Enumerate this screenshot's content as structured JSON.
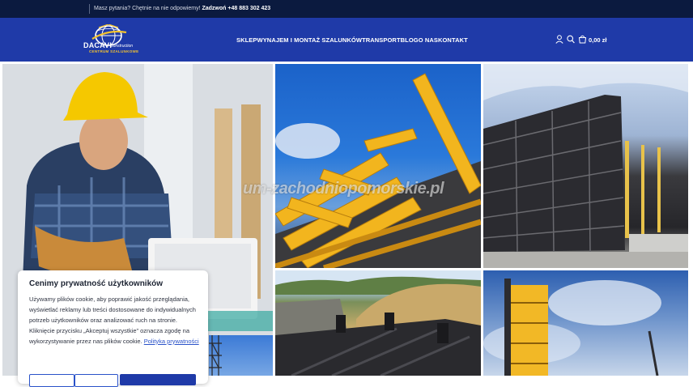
{
  "topbar": {
    "question": "Masz pytania? Chętnie na nie odpowiemy!",
    "call_label": "Zadzwoń",
    "phone": "+48 883 302 423"
  },
  "logo": {
    "name": "DACAVI",
    "sub": "Construction",
    "tagline": "CENTRUM SZALUNKOWE"
  },
  "nav": {
    "items": [
      "SKLEP",
      "WYNAJEM I MONTAŻ SZALUNKÓW",
      "TRANSPORT",
      "BLOG",
      "O NAS",
      "KONTAKT"
    ]
  },
  "header": {
    "icons": [
      "user-icon",
      "search-icon",
      "cart-icon"
    ],
    "cart_total": "0,00 zł"
  },
  "gallery": {
    "watermark": "um-zachodniopomorskie.pl"
  },
  "cookie": {
    "title": "Cenimy prywatność użytkowników",
    "body": "Używamy plików cookie, aby poprawić jakość przeglądania, wyświetlać reklamy lub treści dostosowane do indywidualnych potrzeb użytkowników oraz analizować ruch na stronie. Kliknięcie przycisku „Akceptuj wszystkie” oznacza zgodę na wykorzystywanie przez nas plików cookie.",
    "policy_link": "Polityka prywatności"
  },
  "colors": {
    "topbar_bg": "#0b1a3f",
    "header_bg": "#1f3aa8",
    "accent_yellow": "#f2c230",
    "link": "#2a52c9"
  }
}
